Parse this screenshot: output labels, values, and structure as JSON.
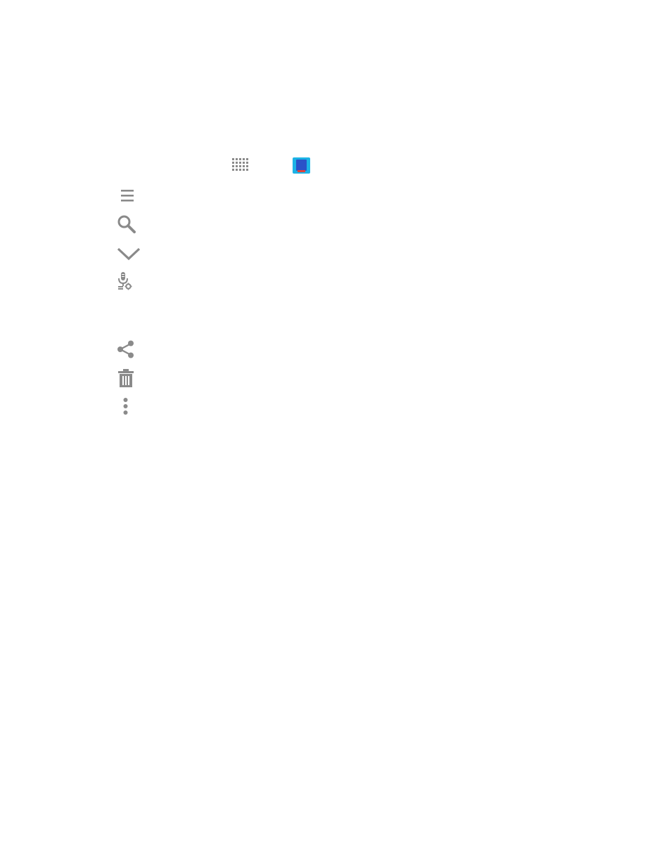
{
  "icons": {
    "inline_row": [
      "apps-grid-icon",
      "app-tile-icon"
    ],
    "list": [
      "menu-icon",
      "search-icon",
      "chevron-down-icon",
      "voice-settings-icon",
      "share-icon",
      "trash-icon",
      "more-options-icon"
    ]
  },
  "colors": {
    "icon_gray": "#8a8a8a",
    "tile_cyan": "#1cb3e6",
    "tile_blue": "#2a52c8",
    "tile_red": "#e0433b"
  }
}
